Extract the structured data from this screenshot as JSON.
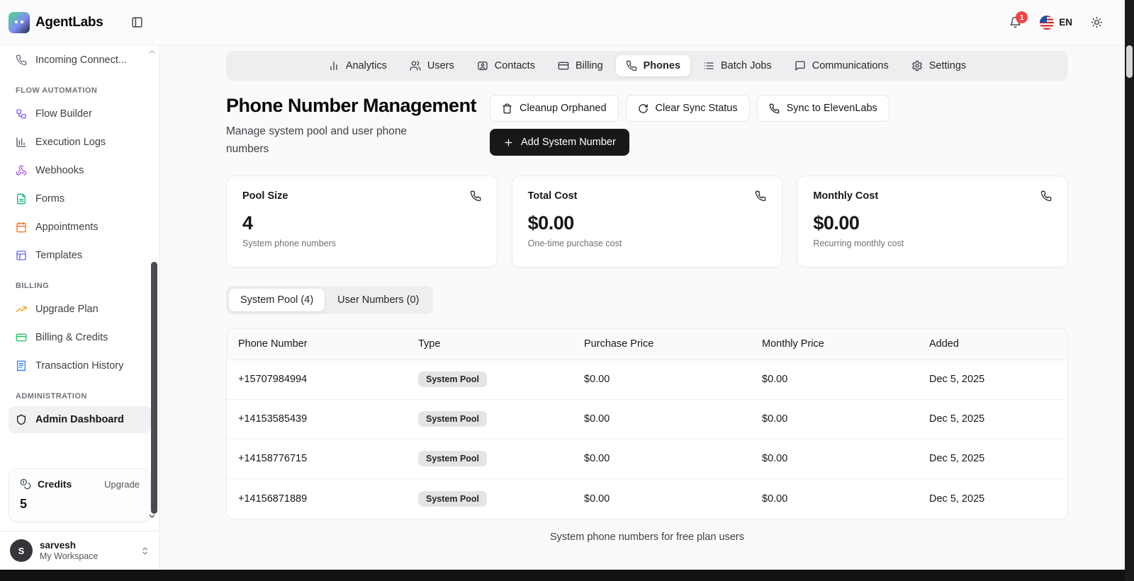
{
  "colors": {
    "accent": "#18181b",
    "notification_badge": "#ef4444",
    "active_tab_bg": "#ffffff",
    "tabstrip_bg": "#eeeef0"
  },
  "header": {
    "brand": "AgentLabs",
    "notification_count": "1",
    "language": "EN"
  },
  "sidebar": {
    "scroll_top_item": "Incoming Connect...",
    "sections": [
      {
        "title": "FLOW AUTOMATION",
        "items": [
          {
            "label": "Flow Builder",
            "icon": "flow-builder-icon"
          },
          {
            "label": "Execution Logs",
            "icon": "execution-logs-icon"
          },
          {
            "label": "Webhooks",
            "icon": "webhooks-icon"
          },
          {
            "label": "Forms",
            "icon": "forms-icon"
          },
          {
            "label": "Appointments",
            "icon": "appointments-icon"
          },
          {
            "label": "Templates",
            "icon": "templates-icon"
          }
        ]
      },
      {
        "title": "BILLING",
        "items": [
          {
            "label": "Upgrade Plan",
            "icon": "upgrade-plan-icon"
          },
          {
            "label": "Billing & Credits",
            "icon": "billing-credits-icon"
          },
          {
            "label": "Transaction History",
            "icon": "transaction-history-icon"
          }
        ]
      },
      {
        "title": "ADMINISTRATION",
        "items": [
          {
            "label": "Admin Dashboard",
            "icon": "shield-icon",
            "active": true
          }
        ]
      }
    ],
    "credits": {
      "label": "Credits",
      "action": "Upgrade",
      "value": "5",
      "icon": "coins-icon"
    },
    "workspace": {
      "avatar_initial": "S",
      "name": "sarvesh",
      "subtitle": "My Workspace"
    }
  },
  "tabs": [
    {
      "label": "Analytics",
      "icon": "bar-chart-icon"
    },
    {
      "label": "Users",
      "icon": "users-icon"
    },
    {
      "label": "Contacts",
      "icon": "contact-card-icon"
    },
    {
      "label": "Billing",
      "icon": "credit-card-icon"
    },
    {
      "label": "Phones",
      "icon": "phone-icon",
      "active": true
    },
    {
      "label": "Batch Jobs",
      "icon": "list-icon"
    },
    {
      "label": "Communications",
      "icon": "chat-icon"
    },
    {
      "label": "Settings",
      "icon": "gear-icon"
    }
  ],
  "page": {
    "title": "Phone Number Management",
    "subtitle": "Manage system pool and user phone numbers",
    "actions": {
      "cleanup": "Cleanup Orphaned",
      "clear_sync": "Clear Sync Status",
      "sync": "Sync to ElevenLabs",
      "add": "Add System Number"
    }
  },
  "stats": [
    {
      "title": "Pool Size",
      "value": "4",
      "caption": "System phone numbers",
      "icon": "phone-icon"
    },
    {
      "title": "Total Cost",
      "value": "$0.00",
      "caption": "One-time purchase cost",
      "icon": "phone-icon"
    },
    {
      "title": "Monthly Cost",
      "value": "$0.00",
      "caption": "Recurring monthly cost",
      "icon": "phone-icon"
    }
  ],
  "pool_tabs": [
    {
      "label": "System Pool (4)",
      "active": true
    },
    {
      "label": "User Numbers (0)"
    }
  ],
  "table": {
    "headers": [
      "Phone Number",
      "Type",
      "Purchase Price",
      "Monthly Price",
      "Added"
    ],
    "rows": [
      {
        "phone": "+15707984994",
        "type": "System Pool",
        "purchase_price": "$0.00",
        "monthly_price": "$0.00",
        "added": "Dec 5, 2025"
      },
      {
        "phone": "+14153585439",
        "type": "System Pool",
        "purchase_price": "$0.00",
        "monthly_price": "$0.00",
        "added": "Dec 5, 2025"
      },
      {
        "phone": "+14158776715",
        "type": "System Pool",
        "purchase_price": "$0.00",
        "monthly_price": "$0.00",
        "added": "Dec 5, 2025"
      },
      {
        "phone": "+14156871889",
        "type": "System Pool",
        "purchase_price": "$0.00",
        "monthly_price": "$0.00",
        "added": "Dec 5, 2025"
      }
    ],
    "footer_note": "System phone numbers for free plan users"
  }
}
